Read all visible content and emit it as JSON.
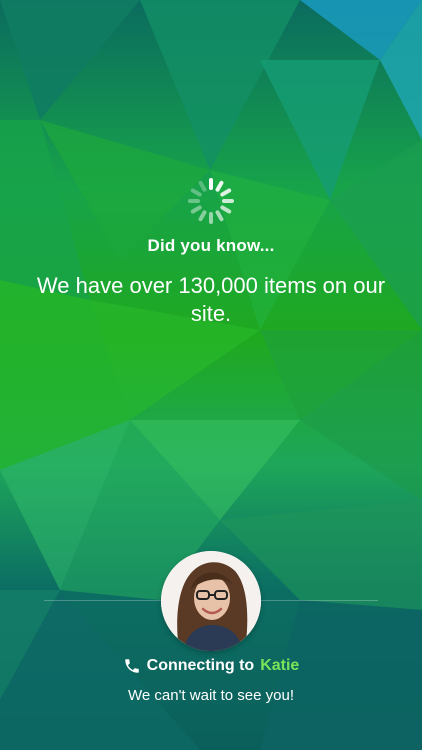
{
  "loading": {
    "heading": "Did you know...",
    "fact": "We have over 130,000 items on our site."
  },
  "connection": {
    "prefix": "Connecting to",
    "agent_name": "Katie",
    "subtext": "We can't wait to see you!"
  },
  "icons": {
    "spinner": "spinner-icon",
    "phone": "phone-icon"
  },
  "colors": {
    "accent_green": "#7ae35a",
    "text": "#ffffff"
  }
}
